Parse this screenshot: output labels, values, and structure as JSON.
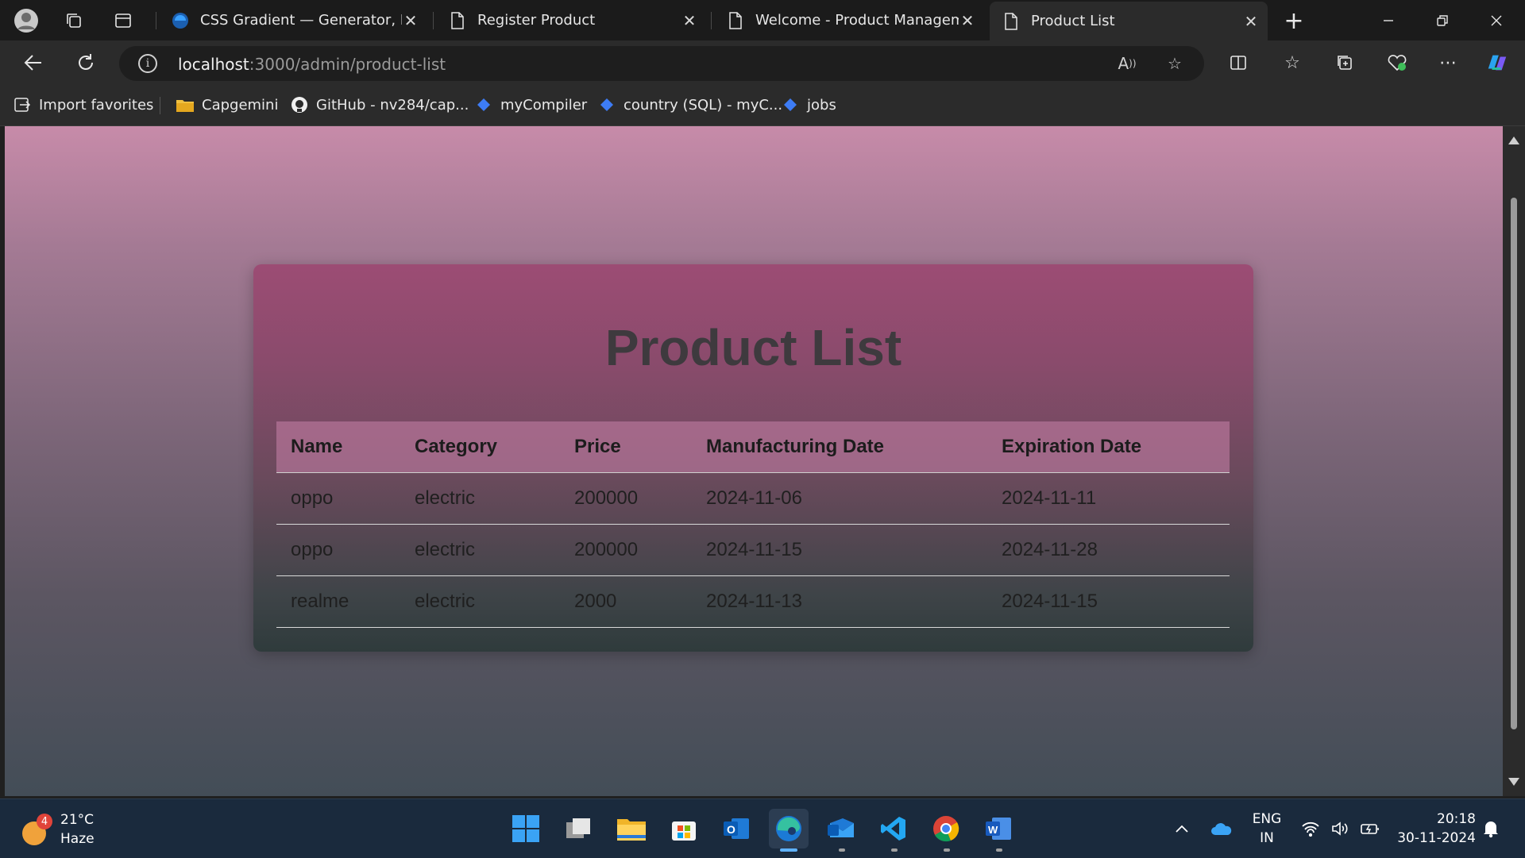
{
  "browser": {
    "tabs": [
      {
        "title": "CSS Gradient — Generator, Mak",
        "icon": "edge-globe-icon",
        "active": false
      },
      {
        "title": "Register Product",
        "icon": "page-icon",
        "active": false
      },
      {
        "title": "Welcome - Product Managemen",
        "icon": "page-icon",
        "active": false
      },
      {
        "title": "Product List",
        "icon": "page-icon",
        "active": true
      }
    ],
    "address": {
      "host": "localhost",
      "path": ":3000/admin/product-list"
    },
    "bookmarks": [
      {
        "label": "Import favorites",
        "icon": "import-icon"
      },
      {
        "label": "Capgemini",
        "icon": "folder-icon"
      },
      {
        "label": "GitHub - nv284/cap...",
        "icon": "github-icon"
      },
      {
        "label": "myCompiler",
        "icon": "diamond-icon"
      },
      {
        "label": "country (SQL) - myC...",
        "icon": "diamond-icon"
      },
      {
        "label": "jobs",
        "icon": "diamond-icon"
      }
    ]
  },
  "page": {
    "title": "Product List",
    "table": {
      "headers": [
        "Name",
        "Category",
        "Price",
        "Manufacturing Date",
        "Expiration Date"
      ],
      "rows": [
        [
          "oppo",
          "electric",
          "200000",
          "2024-11-06",
          "2024-11-11"
        ],
        [
          "oppo",
          "electric",
          "200000",
          "2024-11-15",
          "2024-11-28"
        ],
        [
          "realme",
          "electric",
          "2000",
          "2024-11-13",
          "2024-11-15"
        ]
      ]
    }
  },
  "taskbar": {
    "weather": {
      "temp": "21°C",
      "condition": "Haze",
      "badge": "4"
    },
    "lang": {
      "line1": "ENG",
      "line2": "IN"
    },
    "clock": {
      "time": "20:18",
      "date": "30-11-2024"
    }
  },
  "colors": {
    "accent": "#5fb2ff",
    "header_bg": "#c882aa"
  }
}
